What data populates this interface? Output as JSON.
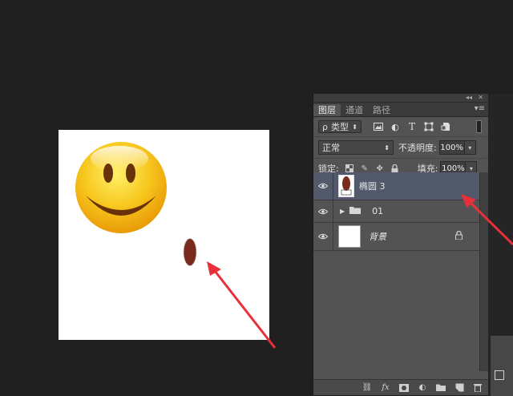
{
  "panel": {
    "tabs": [
      {
        "label": "图层"
      },
      {
        "label": "通道"
      },
      {
        "label": "路径"
      }
    ],
    "filter": {
      "kind_label": "类型",
      "prefix": "ρ"
    },
    "blend_mode": "正常",
    "opacity_label": "不透明度:",
    "opacity_value": "100%",
    "lock_label": "锁定:",
    "fill_label": "填充:",
    "fill_value": "100%"
  },
  "layers": [
    {
      "name": "椭圆 3",
      "visible": true,
      "selected": true,
      "type": "shape"
    },
    {
      "name": "01",
      "visible": true,
      "selected": false,
      "type": "group"
    },
    {
      "name": "背景",
      "visible": true,
      "selected": false,
      "type": "background",
      "locked": true
    }
  ],
  "colors": {
    "selection": "#52596b",
    "annotation_arrow": "#e8303a",
    "ellipse_fill": "#7a2a1c"
  },
  "icons": {
    "eye": "eye-icon",
    "folder": "folder-icon",
    "lock": "lock-icon"
  }
}
